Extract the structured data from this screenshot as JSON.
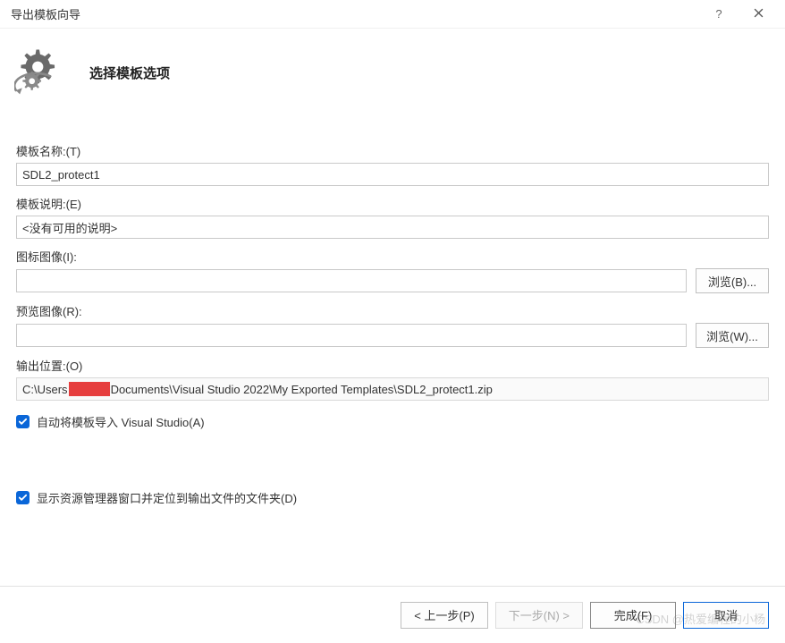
{
  "window": {
    "title": "导出模板向导"
  },
  "header": {
    "title": "选择模板选项"
  },
  "fields": {
    "template_name": {
      "label": "模板名称:(T)",
      "value": "SDL2_protect1"
    },
    "template_desc": {
      "label": "模板说明:(E)",
      "value": "<没有可用的说明>"
    },
    "icon_image": {
      "label": "图标图像(I):",
      "value": "",
      "browse": "浏览(B)..."
    },
    "preview_image": {
      "label": "预览图像(R):",
      "value": "",
      "browse": "浏览(W)..."
    },
    "output_loc": {
      "label": "输出位置:(O)",
      "prefix": "C:\\Users",
      "suffix": "Documents\\Visual Studio 2022\\My Exported Templates\\SDL2_protect1.zip"
    }
  },
  "checks": {
    "auto_import": {
      "label": "自动将模板导入 Visual Studio(A)",
      "checked": true
    },
    "show_explorer": {
      "label": "显示资源管理器窗口并定位到输出文件的文件夹(D)",
      "checked": true
    }
  },
  "footer": {
    "back": "< 上一步(P)",
    "next": "下一步(N) >",
    "finish": "完成(F)",
    "cancel": "取消"
  },
  "watermark": "CSDN @热爱编程的小杨"
}
